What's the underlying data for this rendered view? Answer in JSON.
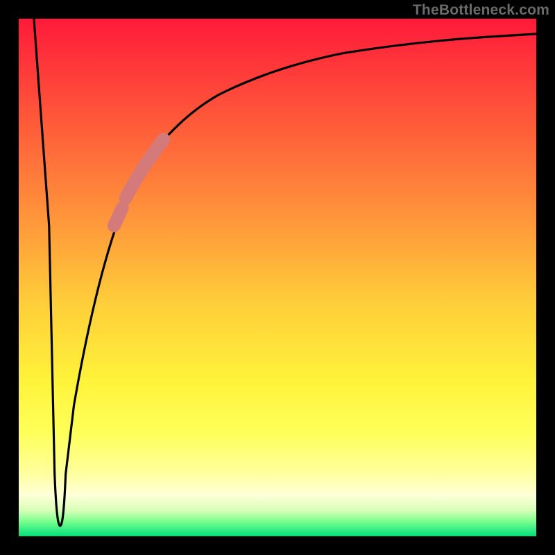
{
  "watermark": "TheBottleneck.com",
  "colors": {
    "frame": "#000000",
    "curve": "#000000",
    "highlight": "#d47a7a",
    "gradient_top": "#ff1a3a",
    "gradient_bottom": "#00e07a"
  },
  "chart_data": {
    "type": "line",
    "title": "",
    "xlabel": "",
    "ylabel": "",
    "xlim": [
      0,
      100
    ],
    "ylim": [
      0,
      100
    ],
    "grid": false,
    "legend": false,
    "series": [
      {
        "name": "bottleneck-curve",
        "x": [
          0,
          3,
          6,
          7,
          8,
          9,
          10,
          12,
          15,
          18,
          20,
          22,
          25,
          28,
          32,
          38,
          45,
          55,
          65,
          80,
          95,
          100
        ],
        "values": [
          100,
          60,
          10,
          2,
          2,
          8,
          18,
          32,
          48,
          58,
          64,
          68,
          73,
          77,
          81,
          85,
          88,
          91,
          93,
          95,
          96.5,
          97
        ]
      },
      {
        "name": "highlight-segment",
        "x": [
          19.5,
          20.5,
          21.5,
          22.5,
          23.5,
          24.5,
          25.5,
          26.5,
          27.5,
          28.5
        ],
        "values": [
          45,
          50,
          54,
          57,
          60,
          63,
          66,
          68,
          70,
          72
        ]
      }
    ],
    "annotations": []
  }
}
